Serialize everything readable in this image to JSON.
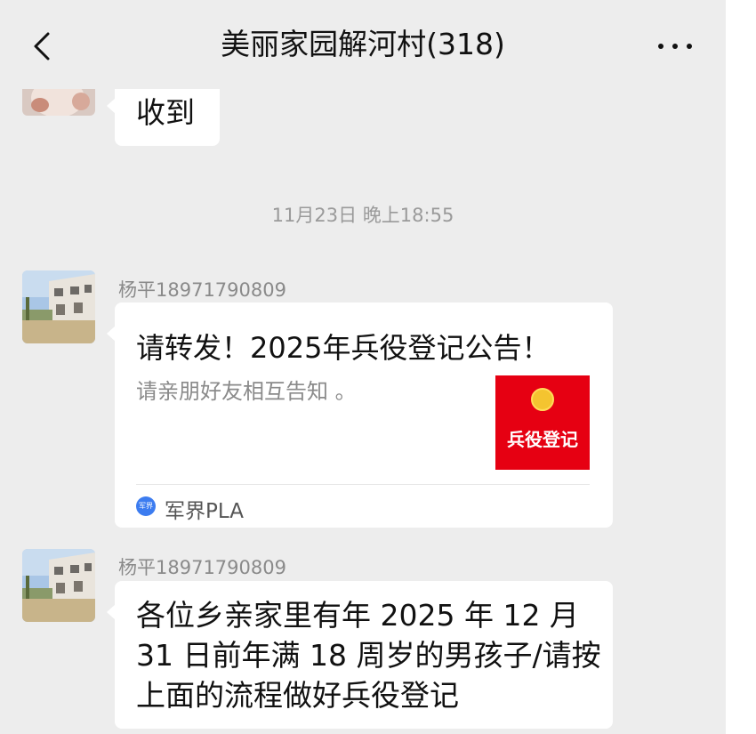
{
  "header": {
    "title": "美丽家园解河村(318)"
  },
  "messages": {
    "first": {
      "text": "收到"
    },
    "timestamp": "11月23日 晚上18:55",
    "card": {
      "sender": "杨平18971790809",
      "title": "请转发！2025年兵役登记公告！",
      "description": "请亲朋好友相互告知 。",
      "thumbnail_text": "兵役登记",
      "source_icon_text": "军界",
      "source_name": "军界PLA"
    },
    "text_msg": {
      "sender": "杨平18971790809",
      "lines": [
        "各位乡亲家里有年 2025 年 12 月",
        "31 日前年满 18 周岁的男孩子/请按",
        "上面的流程做好兵役登记"
      ]
    }
  },
  "colors": {
    "background": "#ededed",
    "bubble": "#ffffff",
    "thumbnail_red": "#e60012",
    "source_blue": "#3c7cf0"
  }
}
